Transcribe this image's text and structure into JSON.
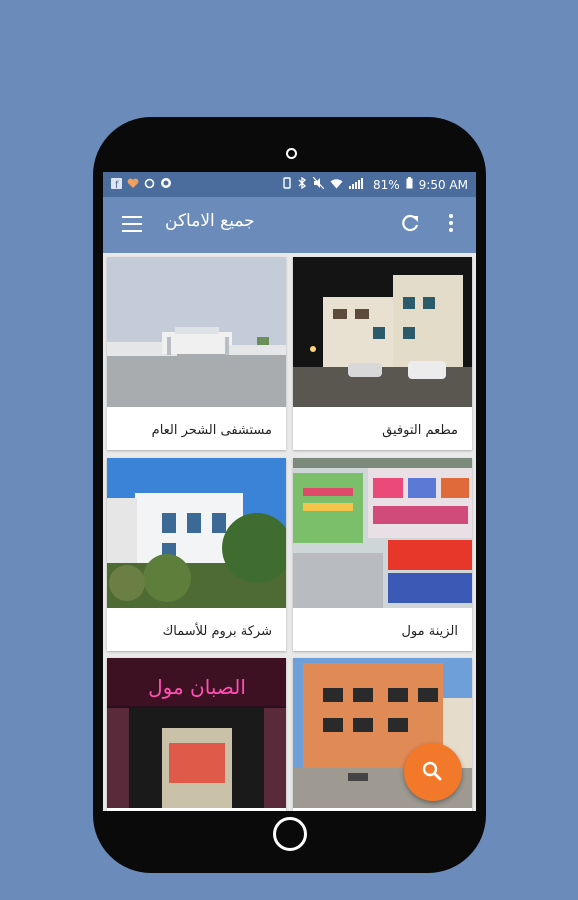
{
  "status_bar": {
    "left_icons": [
      "facebook-icon",
      "heart-icon",
      "recycle-icon",
      "whatsapp-icon"
    ],
    "battery_percent": "81%",
    "time": "9:50 AM"
  },
  "toolbar": {
    "title": "جميع الاماكن",
    "background_color": "#6b8cba"
  },
  "places": [
    {
      "name": "مستشفى الشحر العام"
    },
    {
      "name": "مطعم التوفيق"
    },
    {
      "name": "شركة بروم للأسماك"
    },
    {
      "name": "الزينة مول"
    },
    {
      "name": "",
      "sign_text": "الصبان مول"
    },
    {
      "name": ""
    }
  ],
  "fab": {
    "icon": "search-icon",
    "color": "#f2782a"
  }
}
